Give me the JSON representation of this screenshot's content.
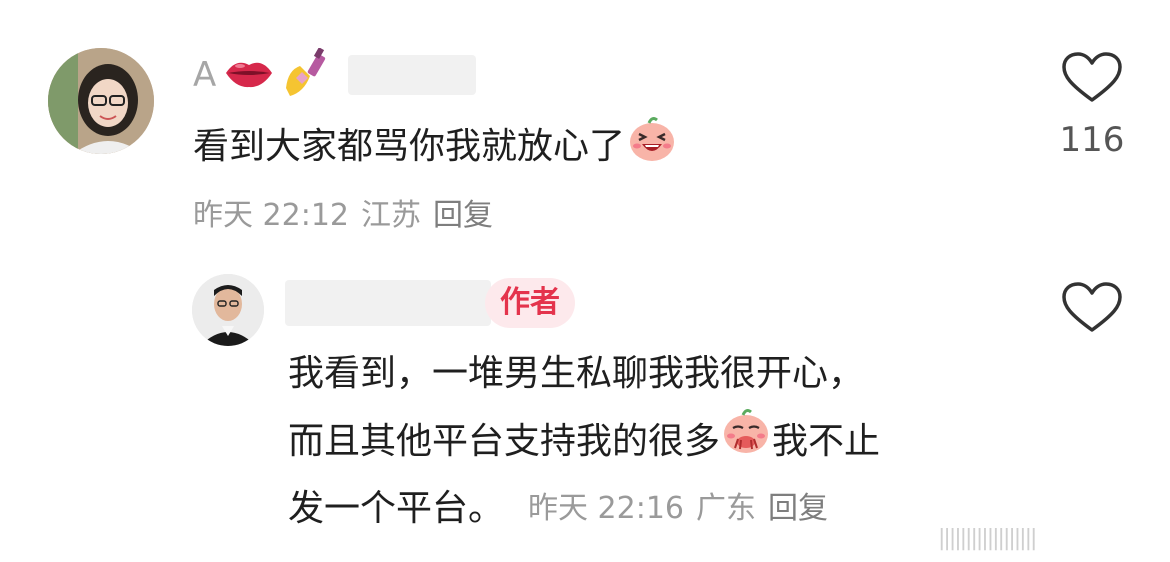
{
  "comment": {
    "username_prefix": "A",
    "username_emojis": [
      "lips-emoji",
      "nail-polish-emoji"
    ],
    "text": "看到大家都骂你我就放心了",
    "time": "昨天 22:12",
    "location": "江苏",
    "reply_label": "回复",
    "like_count": "116"
  },
  "reply": {
    "author_badge": "作者",
    "lines": [
      "我看到，一堆男生私聊我我很开心，",
      "而且其他平台支持我的很多",
      "我不止",
      "发一个平台。"
    ],
    "time": "昨天 22:16",
    "location": "广东",
    "reply_label": "回复"
  },
  "watermark": "||||||||||||||||||"
}
